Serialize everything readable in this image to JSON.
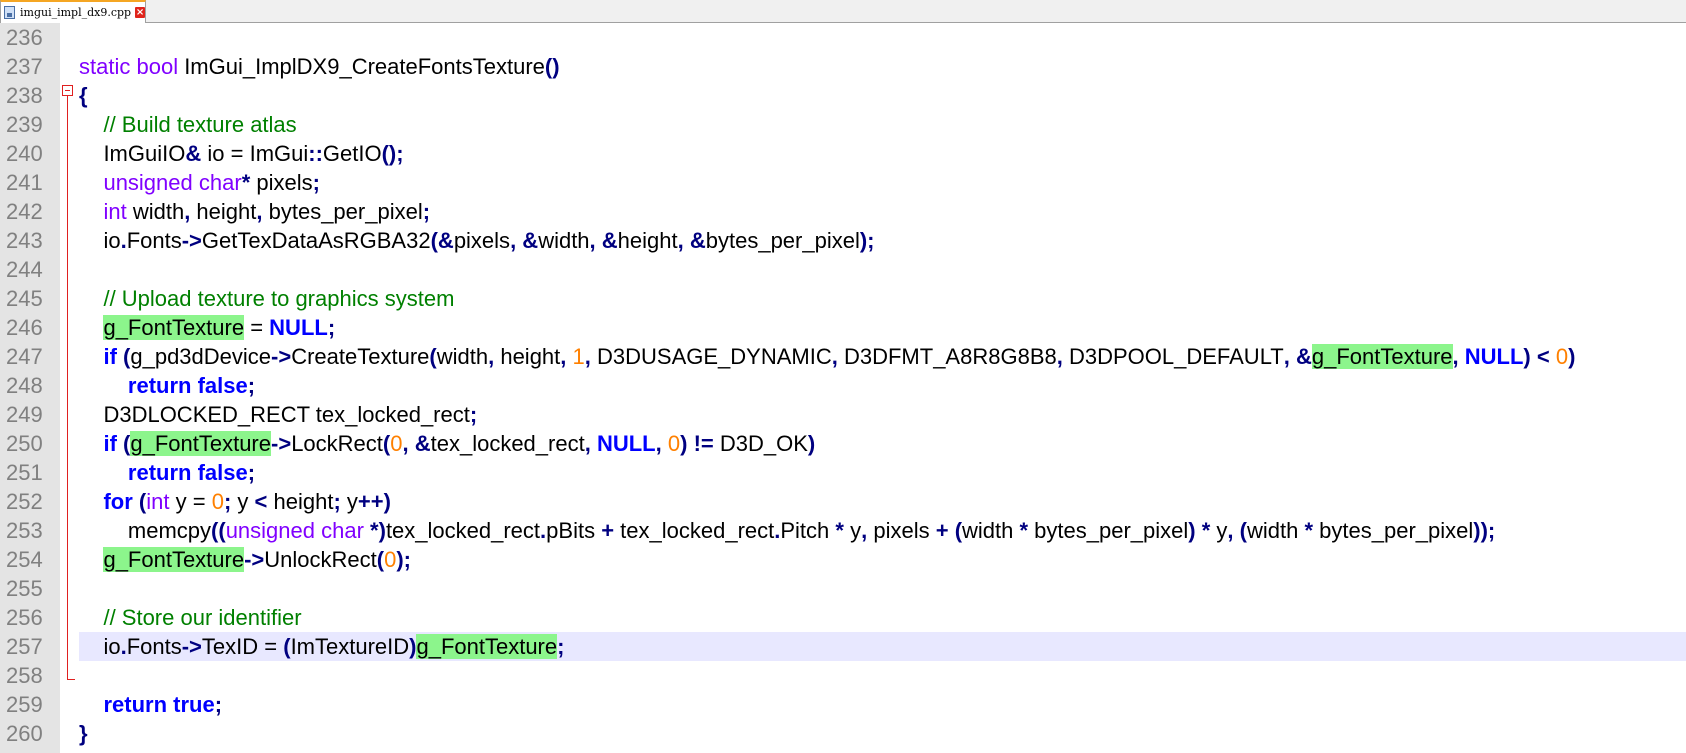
{
  "tab": {
    "title": "imgui_impl_dx9.cpp",
    "close_label": "×"
  },
  "lines": [
    {
      "n": "236",
      "tokens": []
    },
    {
      "n": "237",
      "tokens": [
        [
          "kw",
          "static"
        ],
        [
          "id",
          " "
        ],
        [
          "kw",
          "bool"
        ],
        [
          "id",
          " ImGui_ImplDX9_CreateFontsTexture"
        ],
        [
          "op",
          "()"
        ]
      ]
    },
    {
      "n": "238",
      "tokens": [
        [
          "op",
          "{"
        ]
      ]
    },
    {
      "n": "239",
      "tokens": [
        [
          "id",
          "    "
        ],
        [
          "cm",
          "// Build texture atlas"
        ]
      ]
    },
    {
      "n": "240",
      "tokens": [
        [
          "id",
          "    ImGuiIO"
        ],
        [
          "op",
          "&"
        ],
        [
          "id",
          " io "
        ],
        [
          "id",
          "="
        ],
        [
          "id",
          " ImGui"
        ],
        [
          "op",
          "::"
        ],
        [
          "id",
          "GetIO"
        ],
        [
          "op",
          "();"
        ]
      ]
    },
    {
      "n": "241",
      "tokens": [
        [
          "id",
          "    "
        ],
        [
          "kw",
          "unsigned"
        ],
        [
          "id",
          " "
        ],
        [
          "kw",
          "char"
        ],
        [
          "op",
          "*"
        ],
        [
          "id",
          " pixels"
        ],
        [
          "op",
          ";"
        ]
      ]
    },
    {
      "n": "242",
      "tokens": [
        [
          "id",
          "    "
        ],
        [
          "kw",
          "int"
        ],
        [
          "id",
          " width"
        ],
        [
          "op",
          ","
        ],
        [
          "id",
          " height"
        ],
        [
          "op",
          ","
        ],
        [
          "id",
          " bytes_per_pixel"
        ],
        [
          "op",
          ";"
        ]
      ]
    },
    {
      "n": "243",
      "tokens": [
        [
          "id",
          "    io"
        ],
        [
          "op",
          "."
        ],
        [
          "id",
          "Fonts"
        ],
        [
          "op",
          "->"
        ],
        [
          "id",
          "GetTexDataAsRGBA32"
        ],
        [
          "op",
          "(&"
        ],
        [
          "id",
          "pixels"
        ],
        [
          "op",
          ", &"
        ],
        [
          "id",
          "width"
        ],
        [
          "op",
          ", &"
        ],
        [
          "id",
          "height"
        ],
        [
          "op",
          ", &"
        ],
        [
          "id",
          "bytes_per_pixel"
        ],
        [
          "op",
          ");"
        ]
      ]
    },
    {
      "n": "244",
      "tokens": []
    },
    {
      "n": "245",
      "tokens": [
        [
          "id",
          "    "
        ],
        [
          "cm",
          "// Upload texture to graphics system"
        ]
      ]
    },
    {
      "n": "246",
      "tokens": [
        [
          "id",
          "    "
        ],
        [
          "hl",
          "g_FontTexture"
        ],
        [
          "id",
          " = "
        ],
        [
          "kw2",
          "NULL"
        ],
        [
          "op",
          ";"
        ]
      ]
    },
    {
      "n": "247",
      "tokens": [
        [
          "id",
          "    "
        ],
        [
          "kw2",
          "if"
        ],
        [
          "id",
          " "
        ],
        [
          "op",
          "("
        ],
        [
          "id",
          "g_pd3dDevice"
        ],
        [
          "op",
          "->"
        ],
        [
          "id",
          "CreateTexture"
        ],
        [
          "op",
          "("
        ],
        [
          "id",
          "width"
        ],
        [
          "op",
          ","
        ],
        [
          "id",
          " height"
        ],
        [
          "op",
          ","
        ],
        [
          "id",
          " "
        ],
        [
          "num",
          "1"
        ],
        [
          "op",
          ","
        ],
        [
          "id",
          " D3DUSAGE_DYNAMIC"
        ],
        [
          "op",
          ","
        ],
        [
          "id",
          " D3DFMT_A8R8G8B8"
        ],
        [
          "op",
          ","
        ],
        [
          "id",
          " D3DPOOL_DEFAULT"
        ],
        [
          "op",
          ", &"
        ],
        [
          "hl",
          "g_FontTexture"
        ],
        [
          "op",
          ","
        ],
        [
          "id",
          " "
        ],
        [
          "kw2",
          "NULL"
        ],
        [
          "op",
          ")"
        ],
        [
          "id",
          " "
        ],
        [
          "op",
          "<"
        ],
        [
          "id",
          " "
        ],
        [
          "num",
          "0"
        ],
        [
          "op",
          ")"
        ]
      ]
    },
    {
      "n": "248",
      "tokens": [
        [
          "id",
          "        "
        ],
        [
          "kw2",
          "return"
        ],
        [
          "id",
          " "
        ],
        [
          "kw2",
          "false"
        ],
        [
          "op",
          ";"
        ]
      ]
    },
    {
      "n": "249",
      "tokens": [
        [
          "id",
          "    D3DLOCKED_RECT tex_locked_rect"
        ],
        [
          "op",
          ";"
        ]
      ]
    },
    {
      "n": "250",
      "tokens": [
        [
          "id",
          "    "
        ],
        [
          "kw2",
          "if"
        ],
        [
          "id",
          " "
        ],
        [
          "op",
          "("
        ],
        [
          "hl",
          "g_FontTexture"
        ],
        [
          "op",
          "->"
        ],
        [
          "id",
          "LockRect"
        ],
        [
          "op",
          "("
        ],
        [
          "num",
          "0"
        ],
        [
          "op",
          ", &"
        ],
        [
          "id",
          "tex_locked_rect"
        ],
        [
          "op",
          ","
        ],
        [
          "id",
          " "
        ],
        [
          "kw2",
          "NULL"
        ],
        [
          "op",
          ","
        ],
        [
          "id",
          " "
        ],
        [
          "num",
          "0"
        ],
        [
          "op",
          ")"
        ],
        [
          "id",
          " "
        ],
        [
          "op",
          "!="
        ],
        [
          "id",
          " D3D_OK"
        ],
        [
          "op",
          ")"
        ]
      ]
    },
    {
      "n": "251",
      "tokens": [
        [
          "id",
          "        "
        ],
        [
          "kw2",
          "return"
        ],
        [
          "id",
          " "
        ],
        [
          "kw2",
          "false"
        ],
        [
          "op",
          ";"
        ]
      ]
    },
    {
      "n": "252",
      "tokens": [
        [
          "id",
          "    "
        ],
        [
          "kw2",
          "for"
        ],
        [
          "id",
          " "
        ],
        [
          "op",
          "("
        ],
        [
          "kw",
          "int"
        ],
        [
          "id",
          " y "
        ],
        [
          "id",
          "="
        ],
        [
          "id",
          " "
        ],
        [
          "num",
          "0"
        ],
        [
          "op",
          ";"
        ],
        [
          "id",
          " y "
        ],
        [
          "op",
          "<"
        ],
        [
          "id",
          " height"
        ],
        [
          "op",
          ";"
        ],
        [
          "id",
          " y"
        ],
        [
          "op",
          "++)"
        ]
      ]
    },
    {
      "n": "253",
      "tokens": [
        [
          "id",
          "        memcpy"
        ],
        [
          "op",
          "(("
        ],
        [
          "kw",
          "unsigned"
        ],
        [
          "id",
          " "
        ],
        [
          "kw",
          "char"
        ],
        [
          "id",
          " "
        ],
        [
          "op",
          "*)"
        ],
        [
          "id",
          "tex_locked_rect"
        ],
        [
          "op",
          "."
        ],
        [
          "id",
          "pBits "
        ],
        [
          "op",
          "+"
        ],
        [
          "id",
          " tex_locked_rect"
        ],
        [
          "op",
          "."
        ],
        [
          "id",
          "Pitch "
        ],
        [
          "op",
          "*"
        ],
        [
          "id",
          " y"
        ],
        [
          "op",
          ","
        ],
        [
          "id",
          " pixels "
        ],
        [
          "op",
          "+"
        ],
        [
          "id",
          " "
        ],
        [
          "op",
          "("
        ],
        [
          "id",
          "width "
        ],
        [
          "op",
          "*"
        ],
        [
          "id",
          " bytes_per_pixel"
        ],
        [
          "op",
          ")"
        ],
        [
          "id",
          " "
        ],
        [
          "op",
          "*"
        ],
        [
          "id",
          " y"
        ],
        [
          "op",
          ","
        ],
        [
          "id",
          " "
        ],
        [
          "op",
          "("
        ],
        [
          "id",
          "width "
        ],
        [
          "op",
          "*"
        ],
        [
          "id",
          " bytes_per_pixel"
        ],
        [
          "op",
          "));"
        ]
      ]
    },
    {
      "n": "254",
      "tokens": [
        [
          "id",
          "    "
        ],
        [
          "hl",
          "g_FontTexture"
        ],
        [
          "op",
          "->"
        ],
        [
          "id",
          "UnlockRect"
        ],
        [
          "op",
          "("
        ],
        [
          "num",
          "0"
        ],
        [
          "op",
          ");"
        ]
      ]
    },
    {
      "n": "255",
      "tokens": []
    },
    {
      "n": "256",
      "tokens": [
        [
          "id",
          "    "
        ],
        [
          "cm",
          "// Store our identifier"
        ]
      ]
    },
    {
      "n": "257",
      "current": true,
      "tokens": [
        [
          "id",
          "    io"
        ],
        [
          "op",
          "."
        ],
        [
          "id",
          "Fonts"
        ],
        [
          "op",
          "->"
        ],
        [
          "id",
          "TexID = "
        ],
        [
          "op",
          "("
        ],
        [
          "id",
          "ImTextureID"
        ],
        [
          "op",
          ")"
        ],
        [
          "hl",
          "g_FontTexture"
        ],
        [
          "op",
          ";"
        ]
      ]
    },
    {
      "n": "258",
      "tokens": []
    },
    {
      "n": "259",
      "tokens": [
        [
          "id",
          "    "
        ],
        [
          "kw2",
          "return"
        ],
        [
          "id",
          " "
        ],
        [
          "kw2",
          "true"
        ],
        [
          "op",
          ";"
        ]
      ]
    },
    {
      "n": "260",
      "tokens": [
        [
          "op",
          "}"
        ]
      ]
    }
  ],
  "colors": {
    "keyword_type": "#8000ff",
    "keyword_bold": "#0000ff",
    "number": "#ff8000",
    "comment": "#008000",
    "operator": "#000080",
    "highlight": "#8cf58c",
    "current_line": "#e8e8ff",
    "fold_marker": "#e02020"
  }
}
